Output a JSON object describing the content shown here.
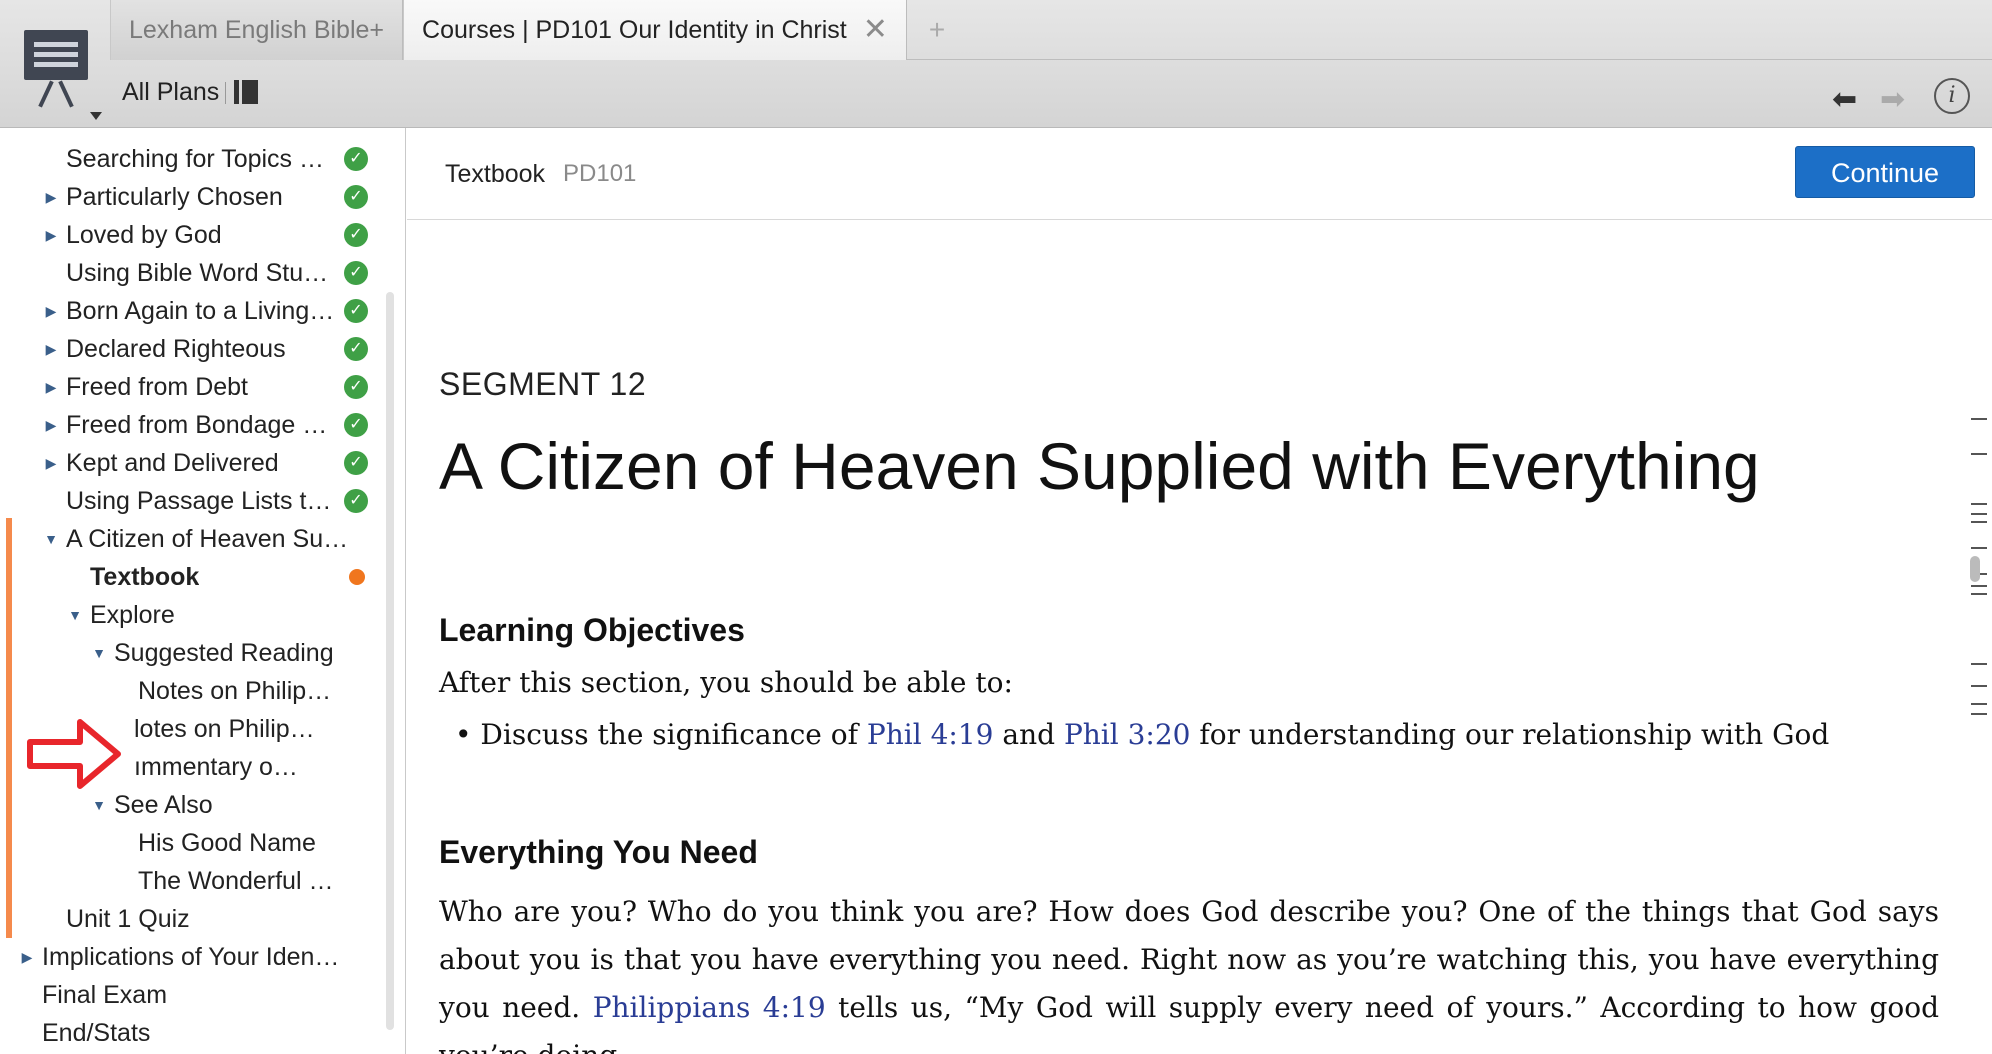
{
  "tabs": [
    {
      "label": "Lexham English Bible+"
    },
    {
      "label": "Courses | PD101 Our Identity in Christ"
    }
  ],
  "tab_close_glyph": "✕",
  "new_tab_glyph": "+",
  "header": {
    "all_plans_label": "All Plans",
    "back_glyph": "⬅",
    "forward_glyph": "➡",
    "info_glyph": "i"
  },
  "sidebar": {
    "items": [
      {
        "label": "Searching for Topics w…",
        "state": "complete"
      },
      {
        "label": "Particularly Chosen",
        "state": "complete"
      },
      {
        "label": "Loved by God",
        "state": "complete"
      },
      {
        "label": "Using Bible Word Stud…",
        "state": "complete"
      },
      {
        "label": "Born Again to a Living …",
        "state": "complete"
      },
      {
        "label": "Declared Righteous",
        "state": "complete"
      },
      {
        "label": "Freed from Debt",
        "state": "complete"
      },
      {
        "label": "Freed from Bondage a…",
        "state": "complete"
      },
      {
        "label": "Kept and Delivered",
        "state": "complete"
      },
      {
        "label": "Using Passage Lists to …",
        "state": "complete"
      },
      {
        "label": "A Citizen of Heaven Su…",
        "state": "open"
      },
      {
        "label": "Textbook",
        "state": "current"
      },
      {
        "label": "Explore",
        "state": "open"
      },
      {
        "label": "Suggested Reading",
        "state": "open"
      },
      {
        "label": "Notes on Philip…",
        "state": "none"
      },
      {
        "label": "lotes on Philip…",
        "state": "none"
      },
      {
        "label": "ımmentary o…",
        "state": "none"
      },
      {
        "label": "See Also",
        "state": "open"
      },
      {
        "label": "His Good Name",
        "state": "none"
      },
      {
        "label": "The Wonderful …",
        "state": "none"
      },
      {
        "label": "Unit 1 Quiz",
        "state": "none"
      },
      {
        "label": "Implications of Your Iden…",
        "state": "none"
      },
      {
        "label": "Final Exam",
        "state": "none"
      },
      {
        "label": "End/Stats",
        "state": "none"
      }
    ],
    "check_glyph": "✓",
    "expand_glyph": "▶",
    "collapse_glyph": "▼"
  },
  "main": {
    "toolbar": {
      "section_label": "Textbook",
      "course_code": "PD101",
      "continue_label": "Continue"
    },
    "segment_label": "SEGMENT 12",
    "title": "A Citizen of Heaven Supplied with Everything",
    "objectives": {
      "heading": "Learning Objectives",
      "intro": "After this section, you should be able to:",
      "bullet": "•",
      "item_before": "Discuss the significance of",
      "link1": "Phil 4:19",
      "item_and": "and",
      "link2": "Phil 3:20",
      "item_after": "for understanding our relationship with God"
    },
    "section2": {
      "heading": "Everything You Need",
      "body_before": "Who are you? Who do you think you are? How does God describe you? One of the things that God says about you is that you have everything you need. Right now as you’re watching this, you have everything you need.",
      "body_link": "Philippians 4:19",
      "body_after": "tells us, “My God will supply every need of yours.” According to how good you’re doing"
    }
  },
  "colors": {
    "accent_button": "#1c6fc7",
    "check_green": "#3fa046",
    "current_dot": "#f0761e",
    "progress_bar": "#f58a4c",
    "link": "#2a3d95",
    "annotation_arrow": "#e8262b"
  },
  "icons": {
    "panel": "presentation-board-icon",
    "layout": "panel-layout-icon",
    "back": "arrow-left-icon",
    "forward": "arrow-right-icon",
    "info": "info-icon",
    "check": "check-circle-icon",
    "current": "dot-icon",
    "annotation": "red-arrow-icon"
  }
}
